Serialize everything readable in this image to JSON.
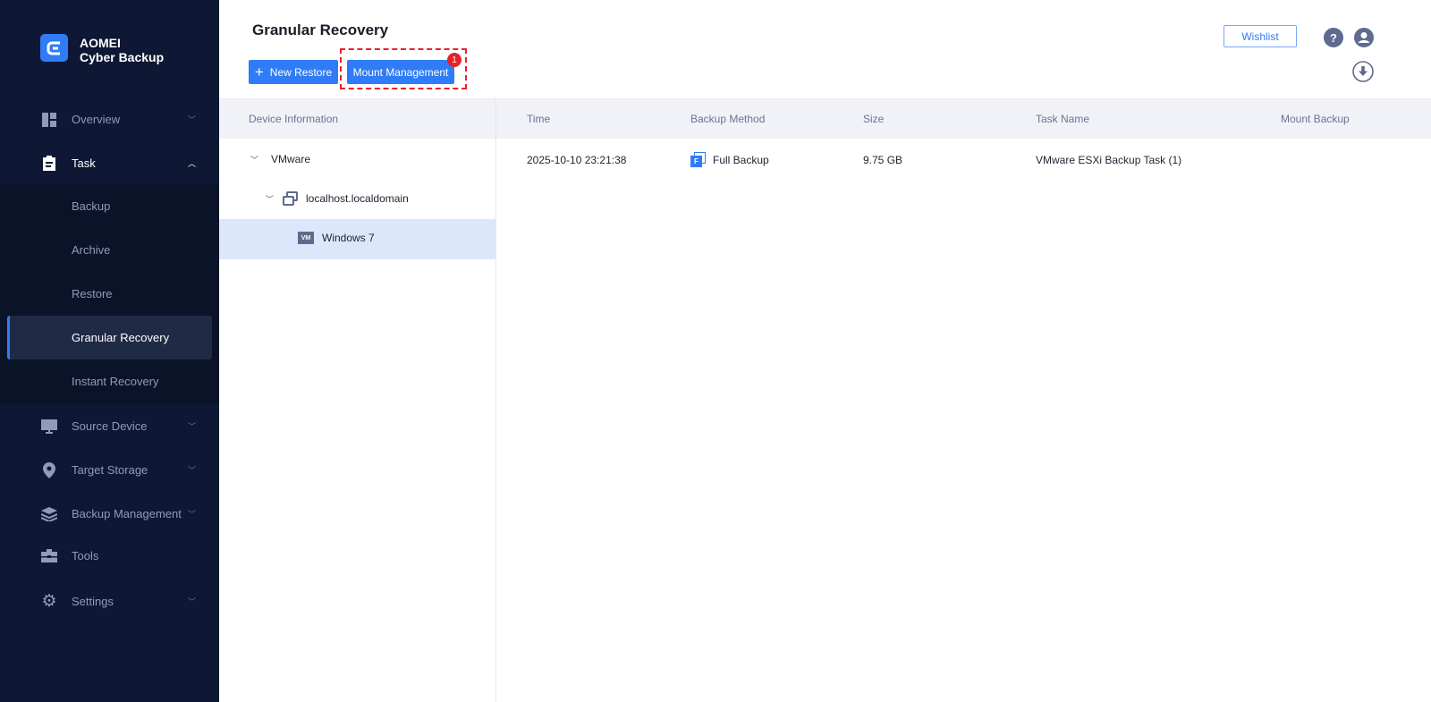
{
  "app": {
    "name_line1": "AOMEI",
    "name_line2": "Cyber Backup"
  },
  "sidebar": {
    "items": [
      {
        "label": "Overview",
        "icon": "dashboard-icon"
      },
      {
        "label": "Task",
        "icon": "clipboard-icon"
      },
      {
        "label": "Source Device",
        "icon": "monitor-icon"
      },
      {
        "label": "Target Storage",
        "icon": "location-pin-icon"
      },
      {
        "label": "Backup Management",
        "icon": "layers-icon"
      },
      {
        "label": "Tools",
        "icon": "toolbox-icon"
      },
      {
        "label": "Settings",
        "icon": "gear-icon"
      }
    ],
    "task_sub": [
      "Backup",
      "Archive",
      "Restore",
      "Granular Recovery",
      "Instant Recovery"
    ]
  },
  "header": {
    "title": "Granular Recovery",
    "new_restore": "New Restore",
    "mount_management": "Mount Management",
    "badge": "1",
    "wishlist": "Wishlist",
    "help": "?"
  },
  "device_panel": {
    "header": "Device Information",
    "tree": [
      "VMware",
      "localhost.localdomain",
      "Windows 7"
    ],
    "vm_badge": "VM"
  },
  "table": {
    "columns": [
      "Time",
      "Backup Method",
      "Size",
      "Task Name",
      "Mount Backup"
    ],
    "rows": [
      {
        "time": "2025-10-10 23:21:38",
        "method": "Full Backup",
        "method_badge": "F",
        "size": "9.75 GB",
        "task": "VMware ESXi Backup Task (1)",
        "mount": ""
      }
    ]
  },
  "colors": {
    "accent": "#2f7cf6",
    "sidebar": "#0e1834",
    "highlight": "#e8202a"
  }
}
